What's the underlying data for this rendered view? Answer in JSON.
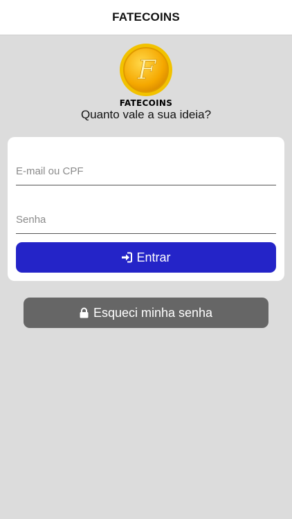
{
  "navbar": {
    "title": "FATECOINS"
  },
  "brand": {
    "logo_text": "FATECOINS",
    "coin_letter": "F",
    "tagline": "Quanto vale a sua ideia?"
  },
  "form": {
    "email": {
      "placeholder": "E-mail ou CPF",
      "value": ""
    },
    "password": {
      "placeholder": "Senha",
      "value": ""
    },
    "login_button": {
      "label": "Entrar",
      "icon": "sign-in-icon"
    }
  },
  "forgot_button": {
    "label": "Esqueci minha senha",
    "icon": "lock-icon"
  },
  "colors": {
    "background": "#dcdcdc",
    "primary": "#2424c8",
    "secondary": "#666666",
    "coin": "#f5b800"
  }
}
